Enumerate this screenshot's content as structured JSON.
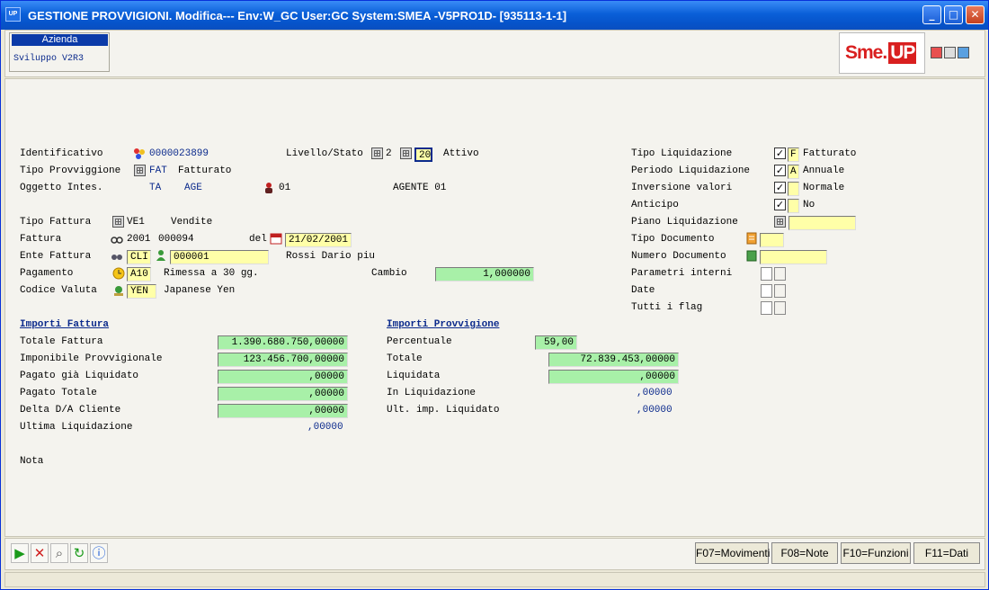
{
  "window": {
    "title": "GESTIONE PROVVIGIONI.  Modifica--- Env:W_GC User:GC System:SMEA -V5PRO1D- [935113-1-1]",
    "app_icon": "UP"
  },
  "header": {
    "azienda_label": "Azienda",
    "azienda_value": "Sviluppo V2R3",
    "logo_sme": "Sme.",
    "logo_up": "UP"
  },
  "form": {
    "identificativo": {
      "label": "Identificativo",
      "value": "0000023899"
    },
    "livello_stato": {
      "label": "Livello/Stato",
      "livello": "2",
      "stato": "20",
      "stato_desc": "Attivo"
    },
    "tipo_provvigione": {
      "label": "Tipo Provviggione",
      "code": "FAT",
      "desc": "Fatturato"
    },
    "oggetto_intes": {
      "label": "Oggetto Intes.",
      "v1": "TA",
      "v2": "AGE",
      "v3": "01",
      "v4": "AGENTE 01"
    },
    "tipo_fattura": {
      "label": "Tipo Fattura",
      "code": "VE1",
      "desc": "Vendite"
    },
    "fattura": {
      "label": "Fattura",
      "anno": "2001",
      "numero": "000094",
      "del_label": "del",
      "data": "21/02/2001"
    },
    "ente_fattura": {
      "label": "Ente Fattura",
      "tipo": "CLI",
      "codice": "000001",
      "desc": "Rossi Dario piu"
    },
    "pagamento": {
      "label": "Pagamento",
      "code": "A10",
      "desc": "Rimessa a 30 gg."
    },
    "cambio": {
      "label": "Cambio",
      "value": "1,000000"
    },
    "codice_valuta": {
      "label": "Codice Valuta",
      "code": "YEN",
      "desc": "Japanese Yen"
    }
  },
  "right": {
    "tipo_liquidazione": {
      "label": "Tipo Liquidazione",
      "code": "F",
      "desc": "Fatturato",
      "checked": true
    },
    "periodo_liquidazione": {
      "label": "Periodo Liquidazione",
      "code": "A",
      "desc": "Annuale",
      "checked": true
    },
    "inversione_valori": {
      "label": "Inversione valori",
      "desc": "Normale",
      "checked": true
    },
    "anticipo": {
      "label": "Anticipo",
      "desc": "No",
      "checked": true
    },
    "piano_liquidazione": {
      "label": "Piano Liquidazione",
      "value": ""
    },
    "tipo_documento": {
      "label": "Tipo Documento",
      "value": ""
    },
    "numero_documento": {
      "label": "Numero Documento",
      "value": ""
    },
    "parametri_interni": {
      "label": "Parametri interni"
    },
    "date": {
      "label": "Date"
    },
    "tutti_flag": {
      "label": "Tutti i flag"
    }
  },
  "importi_fattura": {
    "title": "Importi Fattura",
    "rows": [
      {
        "label": "Totale Fattura",
        "value": "1.390.680.750,00000"
      },
      {
        "label": "Imponibile Provvigionale",
        "value": "123.456.700,00000"
      },
      {
        "label": "Pagato già Liquidato",
        "value": ",00000"
      },
      {
        "label": "Pagato Totale",
        "value": ",00000"
      },
      {
        "label": "Delta D/A Cliente",
        "value": ",00000"
      },
      {
        "label": "Ultima Liquidazione",
        "value": ",00000"
      }
    ]
  },
  "importi_provvigione": {
    "title": "Importi Provvigione",
    "rows": [
      {
        "label": "Percentuale",
        "value": "59,00"
      },
      {
        "label": "Totale",
        "value": "72.839.453,00000"
      },
      {
        "label": "Liquidata",
        "value": ",00000"
      },
      {
        "label": "In Liquidazione",
        "value": ",00000"
      },
      {
        "label": "Ult. imp. Liquidato",
        "value": ",00000"
      }
    ]
  },
  "nota": {
    "label": "Nota"
  },
  "fkeys": [
    "F07=Movimenti",
    "F08=Note",
    "F10=Funzioni",
    "F11=Dati"
  ]
}
